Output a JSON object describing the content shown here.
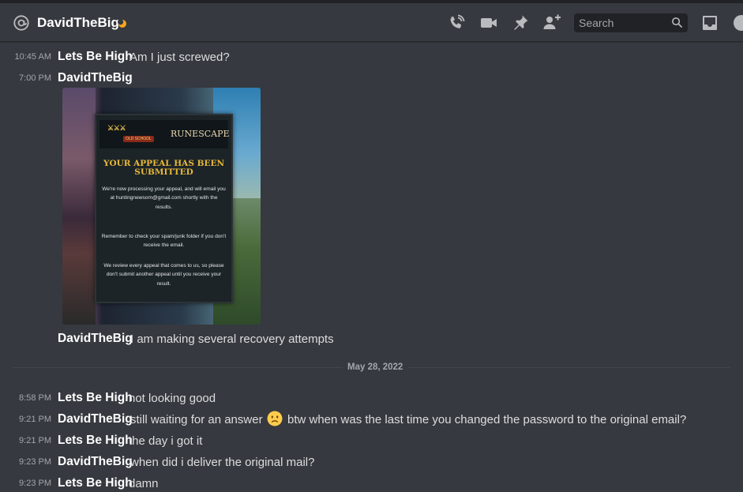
{
  "header": {
    "channel_name": "DavidTheBig",
    "search_placeholder": "Search"
  },
  "icons": {
    "at": "at-icon",
    "status": "idle-moon-icon",
    "call": "phone-call-icon",
    "video": "video-icon",
    "pin": "pin-icon",
    "add_friend": "add-user-icon",
    "search": "search-icon",
    "inbox": "inbox-icon",
    "help": "help-icon"
  },
  "colors": {
    "background": "#36393f",
    "idle_status": "#faa81a",
    "author": "#ffffff",
    "timestamp": "#a3a6aa"
  },
  "messages": [
    {
      "time": "10:45 AM",
      "author": "Lets Be High",
      "text": "Am I just screwed?"
    },
    {
      "time": "7:00 PM",
      "author": "DavidTheBig",
      "text": ""
    },
    {
      "time": "",
      "author": "DavidTheBig",
      "text": "I am making several recovery attempts"
    }
  ],
  "attachment": {
    "logo_left": "OLD SCHOOL",
    "logo_right": "RUNESCAPE",
    "title": "YOUR APPEAL HAS BEEN SUBMITTED",
    "para1": "We're now processing your appeal, and will email you at huntingnewsom@gmail.com shortly with the results.",
    "para2": "Remember to check your spam/junk folder if you don't receive the email.",
    "para3": "We review every appeal that comes to us, so please don't submit another appeal until you receive your result."
  },
  "date_divider": "May 28, 2022",
  "messages2": [
    {
      "time": "8:58 PM",
      "author": "Lets Be High",
      "text": "not looking good"
    },
    {
      "time": "9:21 PM",
      "author": "DavidTheBig",
      "text": "still waiting for an answer",
      "emoji": "slightly-frowning-face",
      "text2": "btw when was the last time you changed the password to the original email?"
    },
    {
      "time": "9:21 PM",
      "author": "Lets Be High",
      "text": "the day i got it"
    },
    {
      "time": "9:23 PM",
      "author": "DavidTheBig",
      "text": "when did i deliver the original mail?"
    },
    {
      "time": "9:23 PM",
      "author": "Lets Be High",
      "text": "damn"
    }
  ]
}
